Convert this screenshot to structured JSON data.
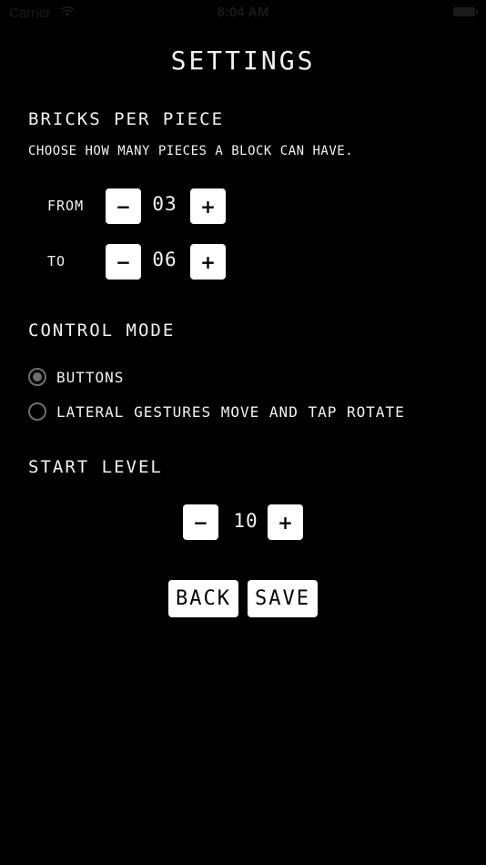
{
  "status_bar": {
    "carrier": "Carrier",
    "time": "8:04 AM",
    "wifi_icon": "wifi-icon",
    "battery_icon": "battery-icon"
  },
  "title": "SETTINGS",
  "bricks": {
    "heading": "BRICKS PER PIECE",
    "description": "CHOOSE HOW MANY PIECES A BLOCK CAN HAVE.",
    "from": {
      "label": "FROM",
      "value": "03",
      "minus": "−",
      "plus": "+"
    },
    "to": {
      "label": "TO",
      "value": "06",
      "minus": "−",
      "plus": "+"
    }
  },
  "control_mode": {
    "heading": "CONTROL MODE",
    "options": [
      {
        "label": "BUTTONS",
        "selected": true
      },
      {
        "label": "LATERAL GESTURES MOVE AND TAP ROTATE",
        "selected": false
      }
    ]
  },
  "start_level": {
    "heading": "START LEVEL",
    "value": "10",
    "minus": "−",
    "plus": "+"
  },
  "actions": {
    "back": "BACK",
    "save": "SAVE"
  },
  "colors": {
    "background": "#000000",
    "text": "#f2f2f2",
    "button_bg": "#ffffff",
    "button_text": "#000000",
    "radio": "#6e6e6e"
  }
}
